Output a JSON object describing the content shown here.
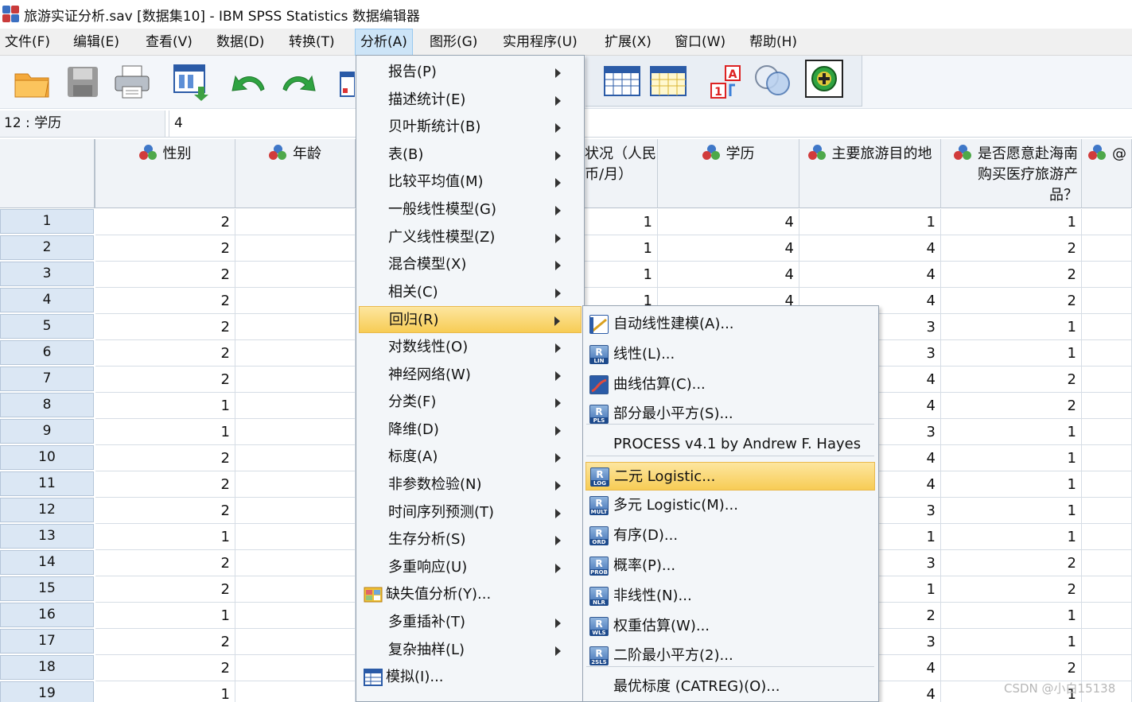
{
  "window": {
    "title": "旅游实证分析.sav [数据集10] - IBM SPSS Statistics 数据编辑器"
  },
  "menubar": [
    "文件(F)",
    "编辑(E)",
    "查看(V)",
    "数据(D)",
    "转换(T)",
    "分析(A)",
    "图形(G)",
    "实用程序(U)",
    "扩展(X)",
    "窗口(W)",
    "帮助(H)"
  ],
  "menubar_active": "分析(A)",
  "locator": {
    "cell_ref": "12 : 学历",
    "cell_value": "4"
  },
  "columns": [
    {
      "label": "性别",
      "has_icon": true
    },
    {
      "label": "年龄",
      "has_icon": true
    },
    {
      "label": "状况（人民\n币/月）",
      "has_icon": false
    },
    {
      "label": "学历",
      "has_icon": true
    },
    {
      "label": "主要旅游目的地",
      "has_icon": true
    },
    {
      "label": "是否愿意赴海南\n购买医疗旅游产\n品？",
      "has_icon": true
    },
    {
      "label": "@",
      "has_icon": true
    }
  ],
  "rows": [
    {
      "n": "1",
      "gender": "2",
      "income": "1",
      "edu": "4",
      "dest": "1",
      "willing": "1"
    },
    {
      "n": "2",
      "gender": "2",
      "income": "1",
      "edu": "4",
      "dest": "4",
      "willing": "2"
    },
    {
      "n": "3",
      "gender": "2",
      "income": "1",
      "edu": "4",
      "dest": "4",
      "willing": "2"
    },
    {
      "n": "4",
      "gender": "2",
      "income": "1",
      "edu": "4",
      "dest": "4",
      "willing": "2"
    },
    {
      "n": "5",
      "gender": "2",
      "income": "",
      "edu": "",
      "dest": "3",
      "willing": "1"
    },
    {
      "n": "6",
      "gender": "2",
      "income": "",
      "edu": "",
      "dest": "3",
      "willing": "1"
    },
    {
      "n": "7",
      "gender": "2",
      "income": "",
      "edu": "",
      "dest": "4",
      "willing": "2"
    },
    {
      "n": "8",
      "gender": "1",
      "income": "",
      "edu": "",
      "dest": "4",
      "willing": "2"
    },
    {
      "n": "9",
      "gender": "1",
      "income": "",
      "edu": "",
      "dest": "3",
      "willing": "1"
    },
    {
      "n": "10",
      "gender": "2",
      "income": "",
      "edu": "",
      "dest": "4",
      "willing": "1"
    },
    {
      "n": "11",
      "gender": "2",
      "income": "",
      "edu": "",
      "dest": "4",
      "willing": "1"
    },
    {
      "n": "12",
      "gender": "2",
      "income": "",
      "edu": "",
      "dest": "3",
      "willing": "1"
    },
    {
      "n": "13",
      "gender": "1",
      "income": "",
      "edu": "",
      "dest": "1",
      "willing": "1"
    },
    {
      "n": "14",
      "gender": "2",
      "income": "",
      "edu": "",
      "dest": "3",
      "willing": "2"
    },
    {
      "n": "15",
      "gender": "2",
      "income": "",
      "edu": "",
      "dest": "1",
      "willing": "2"
    },
    {
      "n": "16",
      "gender": "1",
      "income": "",
      "edu": "",
      "dest": "2",
      "willing": "1"
    },
    {
      "n": "17",
      "gender": "2",
      "income": "",
      "edu": "",
      "dest": "3",
      "willing": "1"
    },
    {
      "n": "18",
      "gender": "2",
      "income": "",
      "edu": "",
      "dest": "4",
      "willing": "2"
    },
    {
      "n": "19",
      "gender": "1",
      "income": "",
      "edu": "",
      "dest": "4",
      "willing": "1"
    }
  ],
  "analyze_menu": [
    {
      "label": "报告(P)",
      "submenu": true
    },
    {
      "label": "描述统计(E)",
      "submenu": true
    },
    {
      "label": "贝叶斯统计(B)",
      "submenu": true
    },
    {
      "label": "表(B)",
      "submenu": true
    },
    {
      "label": "比较平均值(M)",
      "submenu": true
    },
    {
      "label": "一般线性模型(G)",
      "submenu": true
    },
    {
      "label": "广义线性模型(Z)",
      "submenu": true
    },
    {
      "label": "混合模型(X)",
      "submenu": true
    },
    {
      "label": "相关(C)",
      "submenu": true
    },
    {
      "label": "回归(R)",
      "submenu": true,
      "highlighted": true
    },
    {
      "label": "对数线性(O)",
      "submenu": true
    },
    {
      "label": "神经网络(W)",
      "submenu": true
    },
    {
      "label": "分类(F)",
      "submenu": true
    },
    {
      "label": "降维(D)",
      "submenu": true
    },
    {
      "label": "标度(A)",
      "submenu": true
    },
    {
      "label": "非参数检验(N)",
      "submenu": true
    },
    {
      "label": "时间序列预测(T)",
      "submenu": true
    },
    {
      "label": "生存分析(S)",
      "submenu": true
    },
    {
      "label": "多重响应(U)",
      "submenu": true
    },
    {
      "label": "缺失值分析(Y)...",
      "submenu": false,
      "icon": "missing-value-icon"
    },
    {
      "label": "多重插补(T)",
      "submenu": true
    },
    {
      "label": "复杂抽样(L)",
      "submenu": true
    },
    {
      "label": "模拟(I)...",
      "submenu": false,
      "icon": "simulation-icon"
    }
  ],
  "regression_menu": [
    {
      "label": "自动线性建模(A)...",
      "icon_text": ""
    },
    {
      "label": "线性(L)...",
      "icon_text": "LIN"
    },
    {
      "label": "曲线估算(C)...",
      "icon_text": ""
    },
    {
      "label": "部分最小平方(S)...",
      "icon_text": "PLS"
    },
    {
      "label": "PROCESS v4.1 by Andrew F. Hayes",
      "icon_text": "none"
    },
    {
      "label": "二元 Logistic...",
      "icon_text": "LOG",
      "highlighted": true
    },
    {
      "label": "多元 Logistic(M)...",
      "icon_text": "MULT"
    },
    {
      "label": "有序(D)...",
      "icon_text": "ORD"
    },
    {
      "label": "概率(P)...",
      "icon_text": "PROB"
    },
    {
      "label": "非线性(N)...",
      "icon_text": "NLR"
    },
    {
      "label": "权重估算(W)...",
      "icon_text": "WLS"
    },
    {
      "label": "二阶最小平方(2)...",
      "icon_text": "2SLS"
    },
    {
      "label": "最优标度 (CATREG)(O)...",
      "icon_text": "none"
    }
  ],
  "watermark": "CSDN @小白15138",
  "colors": {
    "menu_highlight": "#f7cc55",
    "menubar_active": "#cce4f7",
    "rowhead_bg": "#dbe7f4"
  }
}
